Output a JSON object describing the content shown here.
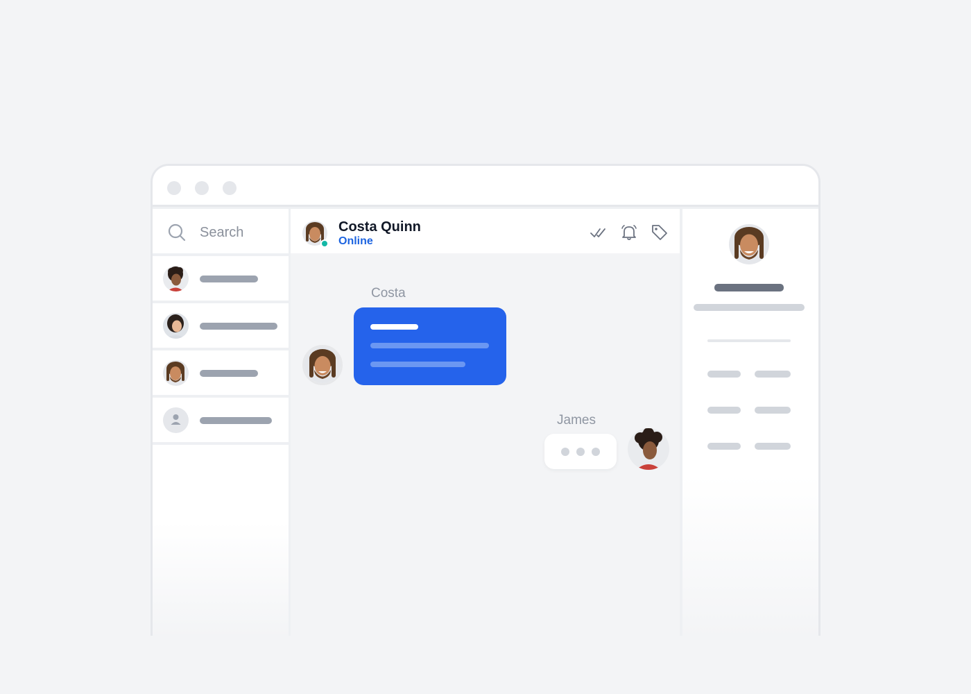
{
  "window": {
    "controls": [
      "close-dot",
      "minimize-dot",
      "maximize-dot"
    ]
  },
  "search": {
    "label": "Search",
    "icon": "search-icon"
  },
  "contacts": [
    {
      "avatar": "curly-hair-person",
      "name_placeholder_width": 0.43
    },
    {
      "avatar": "woman-smiling",
      "name_placeholder_width": 0.57
    },
    {
      "avatar": "bearded-man-dreadlocks",
      "name_placeholder_width": 0.43
    },
    {
      "avatar": "default-user-icon",
      "name_placeholder_width": 0.53
    }
  ],
  "chat_header": {
    "name": "Costa Quinn",
    "status": "Online",
    "status_color": "#14b8a6",
    "actions": [
      "double-check-icon",
      "bell-icon",
      "tag-icon"
    ]
  },
  "messages": [
    {
      "sender": "Costa",
      "type": "text",
      "bubble_color": "#2563eb"
    },
    {
      "sender": "James",
      "type": "typing-indicator"
    }
  ],
  "colors": {
    "accent": "#2563eb",
    "online_text": "#1d64e0",
    "placeholder_line": "#9ca3af",
    "background": "#f3f4f6"
  }
}
